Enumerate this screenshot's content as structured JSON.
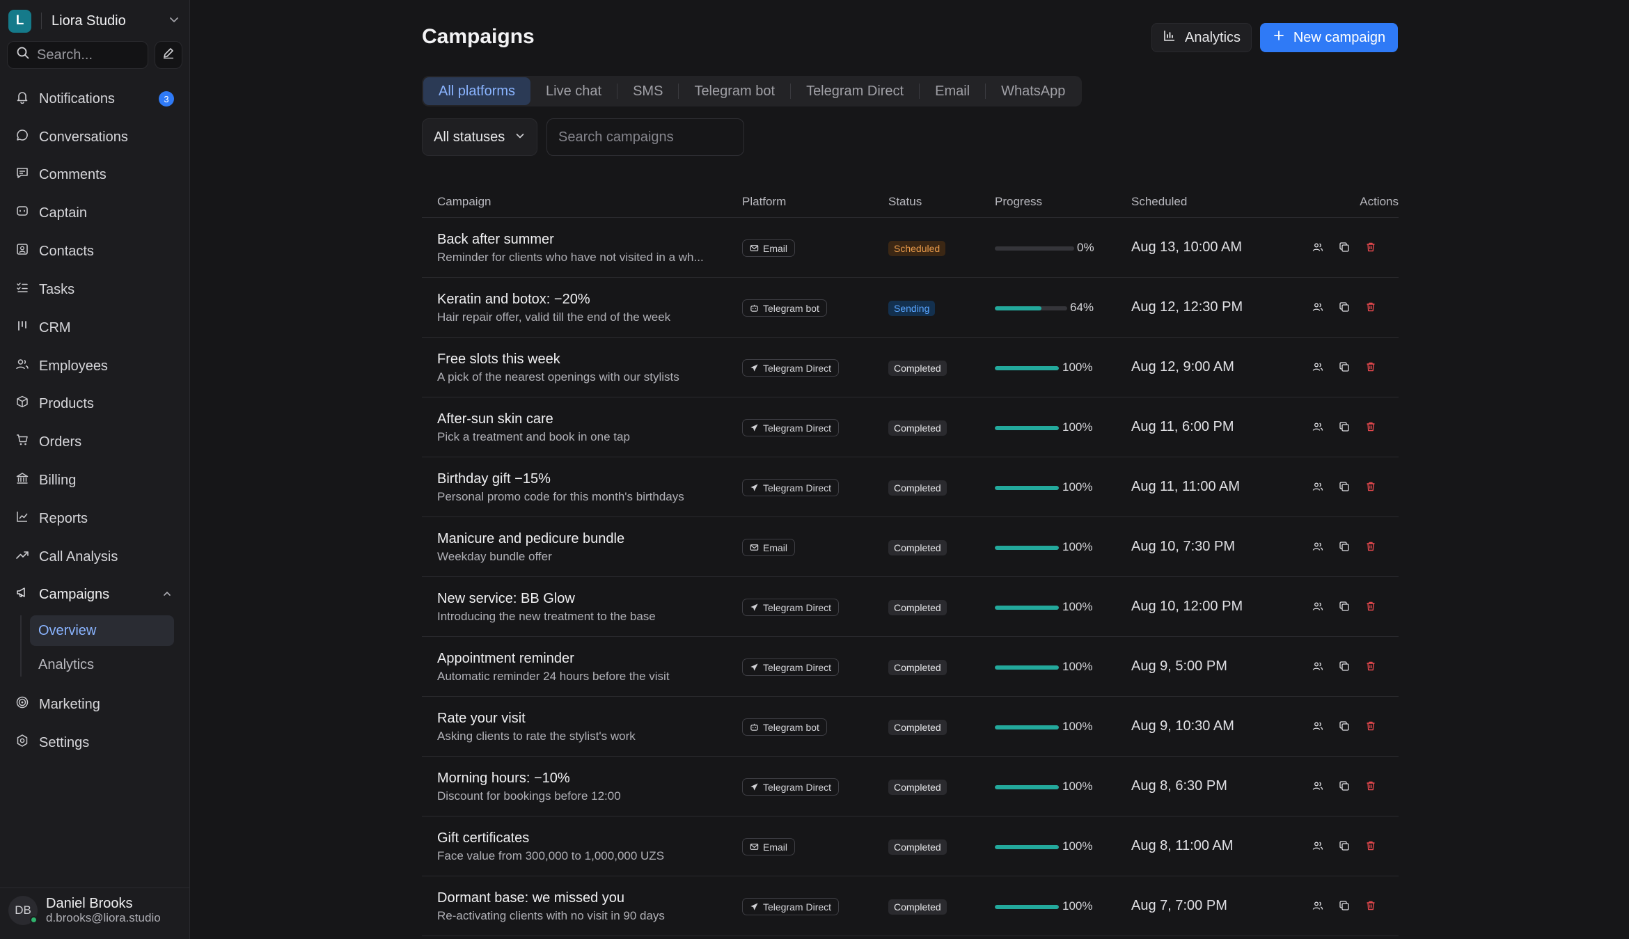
{
  "workspace": {
    "initial": "L",
    "name": "Liora Studio"
  },
  "search": {
    "placeholder": "Search..."
  },
  "nav": [
    {
      "label": "Notifications",
      "icon": "bell-icon",
      "badge": "3"
    },
    {
      "label": "Conversations",
      "icon": "chat-bubble-icon"
    },
    {
      "label": "Comments",
      "icon": "comment-icon"
    },
    {
      "label": "Captain",
      "icon": "bot-icon"
    },
    {
      "label": "Contacts",
      "icon": "contacts-icon"
    },
    {
      "label": "Tasks",
      "icon": "tasks-icon"
    },
    {
      "label": "CRM",
      "icon": "kanban-icon"
    },
    {
      "label": "Employees",
      "icon": "users-icon"
    },
    {
      "label": "Products",
      "icon": "box-icon"
    },
    {
      "label": "Orders",
      "icon": "cart-icon"
    },
    {
      "label": "Billing",
      "icon": "bank-icon"
    },
    {
      "label": "Reports",
      "icon": "line-chart-icon"
    },
    {
      "label": "Call Analysis",
      "icon": "trend-icon"
    },
    {
      "label": "Campaigns",
      "icon": "megaphone-icon"
    }
  ],
  "campaigns_sub": [
    {
      "label": "Overview",
      "active": true
    },
    {
      "label": "Analytics",
      "active": false
    }
  ],
  "nav_bottom": [
    {
      "label": "Marketing",
      "icon": "target-icon"
    },
    {
      "label": "Settings",
      "icon": "gear-icon"
    }
  ],
  "user": {
    "initials": "DB",
    "name": "Daniel Brooks",
    "email": "d.brooks@liora.studio"
  },
  "header": {
    "title": "Campaigns",
    "analytics_label": "Analytics",
    "new_campaign_label": "New campaign"
  },
  "tabs": [
    "All platforms",
    "Live chat",
    "SMS",
    "Telegram bot",
    "Telegram Direct",
    "Email",
    "WhatsApp"
  ],
  "filters": {
    "status_label": "All statuses",
    "search_placeholder": "Search campaigns"
  },
  "columns": {
    "campaign": "Campaign",
    "platform": "Platform",
    "status": "Status",
    "progress": "Progress",
    "scheduled": "Scheduled",
    "actions": "Actions"
  },
  "colors": {
    "accent": "#2f7af6",
    "progress": "#23a99c",
    "scheduled": "#e89a4a",
    "sending": "#59a5ff",
    "delete": "#e5484d"
  },
  "rows": [
    {
      "title": "Back after summer",
      "desc": "Reminder for clients who have not visited in a wh...",
      "platform": "Email",
      "platform_icon": "mail-icon",
      "status": "Scheduled",
      "progress": 0,
      "progress_text": "0%",
      "scheduled": "Aug 13, 10:00 AM"
    },
    {
      "title": "Keratin and botox: −20%",
      "desc": "Hair repair offer, valid till the end of the week",
      "platform": "Telegram bot",
      "platform_icon": "bot-icon",
      "status": "Sending",
      "progress": 64,
      "progress_text": "64%",
      "scheduled": "Aug 12, 12:30 PM"
    },
    {
      "title": "Free slots this week",
      "desc": "A pick of the nearest openings with our stylists",
      "platform": "Telegram Direct",
      "platform_icon": "send-icon",
      "status": "Completed",
      "progress": 100,
      "progress_text": "100%",
      "scheduled": "Aug 12, 9:00 AM"
    },
    {
      "title": "After-sun skin care",
      "desc": "Pick a treatment and book in one tap",
      "platform": "Telegram Direct",
      "platform_icon": "send-icon",
      "status": "Completed",
      "progress": 100,
      "progress_text": "100%",
      "scheduled": "Aug 11, 6:00 PM"
    },
    {
      "title": "Birthday gift −15%",
      "desc": "Personal promo code for this month's birthdays",
      "platform": "Telegram Direct",
      "platform_icon": "send-icon",
      "status": "Completed",
      "progress": 100,
      "progress_text": "100%",
      "scheduled": "Aug 11, 11:00 AM"
    },
    {
      "title": "Manicure and pedicure bundle",
      "desc": "Weekday bundle offer",
      "platform": "Email",
      "platform_icon": "mail-icon",
      "status": "Completed",
      "progress": 100,
      "progress_text": "100%",
      "scheduled": "Aug 10, 7:30 PM"
    },
    {
      "title": "New service: BB Glow",
      "desc": "Introducing the new treatment to the base",
      "platform": "Telegram Direct",
      "platform_icon": "send-icon",
      "status": "Completed",
      "progress": 100,
      "progress_text": "100%",
      "scheduled": "Aug 10, 12:00 PM"
    },
    {
      "title": "Appointment reminder",
      "desc": "Automatic reminder 24 hours before the visit",
      "platform": "Telegram Direct",
      "platform_icon": "send-icon",
      "status": "Completed",
      "progress": 100,
      "progress_text": "100%",
      "scheduled": "Aug 9, 5:00 PM"
    },
    {
      "title": "Rate your visit",
      "desc": "Asking clients to rate the stylist's work",
      "platform": "Telegram bot",
      "platform_icon": "bot-icon",
      "status": "Completed",
      "progress": 100,
      "progress_text": "100%",
      "scheduled": "Aug 9, 10:30 AM"
    },
    {
      "title": "Morning hours: −10%",
      "desc": "Discount for bookings before 12:00",
      "platform": "Telegram Direct",
      "platform_icon": "send-icon",
      "status": "Completed",
      "progress": 100,
      "progress_text": "100%",
      "scheduled": "Aug 8, 6:30 PM"
    },
    {
      "title": "Gift certificates",
      "desc": "Face value from 300,000 to 1,000,000 UZS",
      "platform": "Email",
      "platform_icon": "mail-icon",
      "status": "Completed",
      "progress": 100,
      "progress_text": "100%",
      "scheduled": "Aug 8, 11:00 AM"
    },
    {
      "title": "Dormant base: we missed you",
      "desc": "Re-activating clients with no visit in 90 days",
      "platform": "Telegram Direct",
      "platform_icon": "send-icon",
      "status": "Completed",
      "progress": 100,
      "progress_text": "100%",
      "scheduled": "Aug 7, 7:00 PM"
    }
  ]
}
